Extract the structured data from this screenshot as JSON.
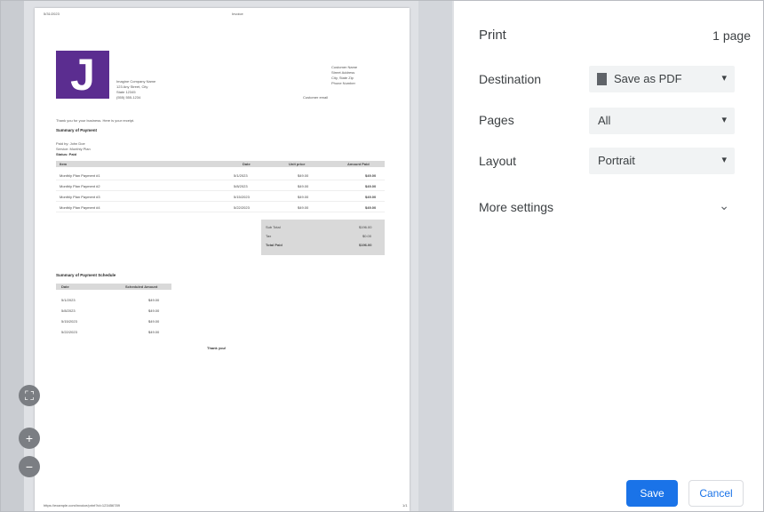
{
  "preview": {
    "header_date": "5/31/2023",
    "header_title": "Invoice",
    "company_lines": [
      "Imagine Company Name",
      "123 Any Street, City",
      "State 12345",
      "(555) 555-1234"
    ],
    "bill_to_lines": [
      "Customer Name",
      "Street Address",
      "City, State Zip",
      "Phone Number",
      "Customer email"
    ],
    "intro_line": "Thank you for your business. Here is your receipt.",
    "summary_heading": "Summary of Payment",
    "summary_sub": [
      "Paid by: John Doe",
      "Service: Monthly Plan",
      "Status: Paid"
    ],
    "table_headers": [
      "Item",
      "Date",
      "Unit price",
      "Amount Paid"
    ],
    "table_rows": [
      [
        "Monthly Plan Payment #1",
        "5/1/2023",
        "$49.00",
        "$49.00"
      ],
      [
        "Monthly Plan Payment #2",
        "5/8/2023",
        "$49.00",
        "$49.00"
      ],
      [
        "Monthly Plan Payment #3",
        "5/15/2023",
        "$49.00",
        "$49.00"
      ],
      [
        "Monthly Plan Payment #4",
        "5/22/2023",
        "$49.00",
        "$49.00"
      ]
    ],
    "totals": [
      [
        "Sub Total",
        "$196.00"
      ],
      [
        "Tax",
        "$0.00"
      ],
      [
        "Total Paid",
        "$196.00"
      ]
    ],
    "schedule_heading": "Summary of Payment Schedule",
    "schedule_headers": [
      "Date",
      "Scheduled Amount"
    ],
    "schedule_rows": [
      [
        "5/1/2023",
        "$49.00"
      ],
      [
        "5/8/2023",
        "$49.00"
      ],
      [
        "5/15/2023",
        "$49.00"
      ],
      [
        "5/22/2023",
        "$49.00"
      ]
    ],
    "thank_you": "Thank you!",
    "footer_url": "https://example.com/invoice/print?id=123456789",
    "footer_page": "1/1",
    "logo_letter": "J"
  },
  "controls": {
    "fit_icon": "fit-to-page-icon",
    "zoom_in_icon": "zoom-in-icon",
    "zoom_out_icon": "zoom-out-icon"
  },
  "settings": {
    "title": "Print",
    "page_count": "1 page",
    "destination_label": "Destination",
    "destination_value": "Save as PDF",
    "pages_label": "Pages",
    "pages_value": "All",
    "layout_label": "Layout",
    "layout_value": "Portrait",
    "more_settings_label": "More settings",
    "save_label": "Save",
    "cancel_label": "Cancel",
    "accent_color": "#1a73e8"
  }
}
